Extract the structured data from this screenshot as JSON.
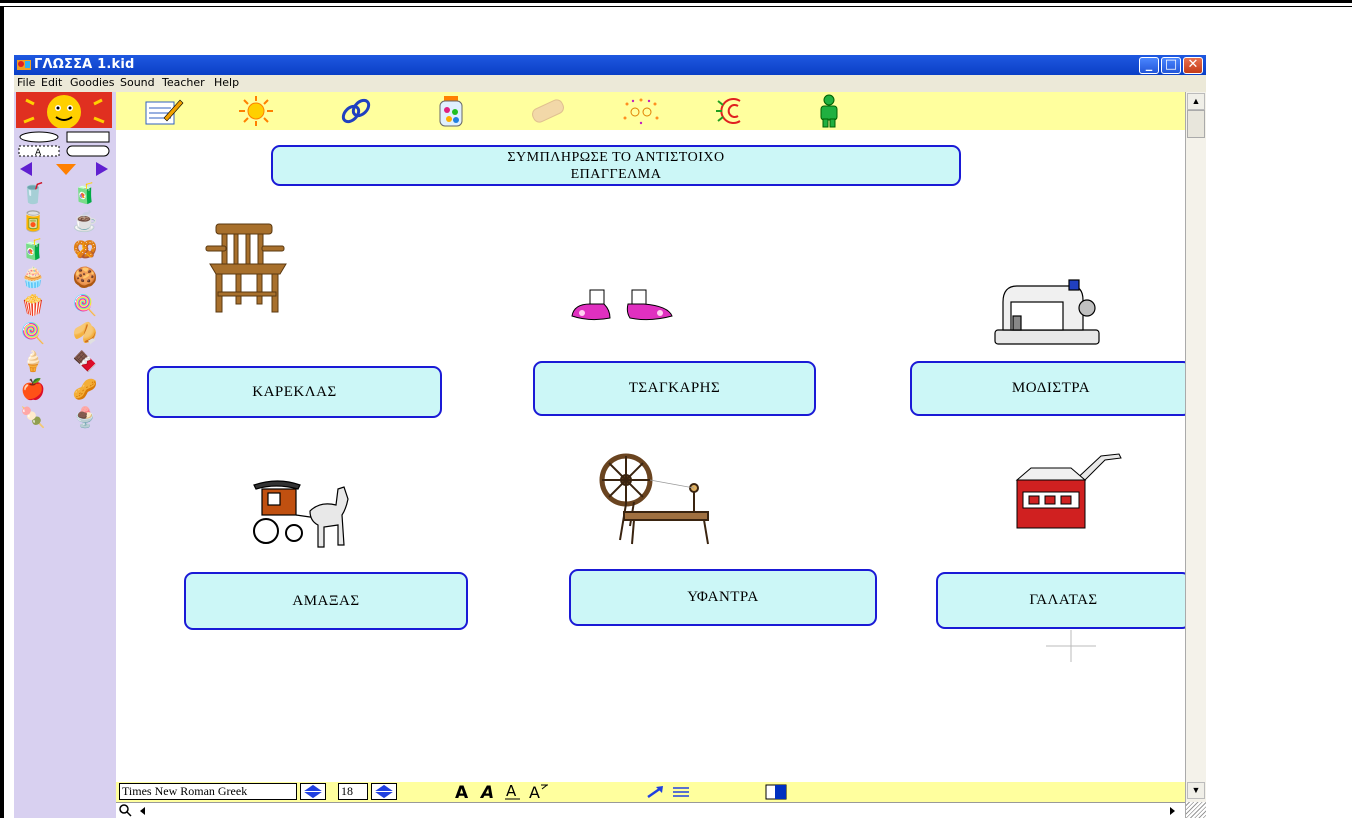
{
  "window": {
    "title": "ΓΛΩΣΣΑ 1.kid",
    "controls": {
      "minimize": "_",
      "maximize": "□",
      "close": "✕"
    }
  },
  "menu": [
    "File",
    "Edit",
    "Goodies",
    "Sound",
    "Teacher",
    "Help"
  ],
  "top_toolbar": [
    {
      "name": "sun-mascot-icon"
    },
    {
      "name": "notepad-pencil-icon"
    },
    {
      "name": "sun-icon"
    },
    {
      "name": "chain-link-icon"
    },
    {
      "name": "candy-jar-icon"
    },
    {
      "name": "eraser-icon"
    },
    {
      "name": "sparkle-face-icon"
    },
    {
      "name": "sound-burst-icon"
    },
    {
      "name": "person-icon"
    }
  ],
  "canvas": {
    "heading_line1": "ΣΥΜΠΛΗΡΩΣΕ ΤΟ ΑΝΤΙΣΤΟΙΧΟ",
    "heading_line2": "ΕΠΑΓΓΕΛΜΑ",
    "labels": {
      "chair": "ΚΑΡΕΚΛΑΣ",
      "shoes": "ΤΣΑΓΚΑΡΗΣ",
      "sewing": "ΜΟΔΙΣΤΡΑ",
      "carriage": "ΑΜΑΞΑΣ",
      "spinning": "ΥΦΑΝΤΡΑ",
      "milk": "ΓΑΛΑΤΑΣ"
    }
  },
  "bottom_toolbar": {
    "font": "Times New Roman Greek",
    "size": "18"
  },
  "colors": {
    "box_fill": "#ccf7f7",
    "box_border": "#1a1ad6",
    "toolbar_yellow": "#ffff9e",
    "toolbox_lavender": "#d8d0f0",
    "titlebar_blue": "#0a3fc6"
  }
}
